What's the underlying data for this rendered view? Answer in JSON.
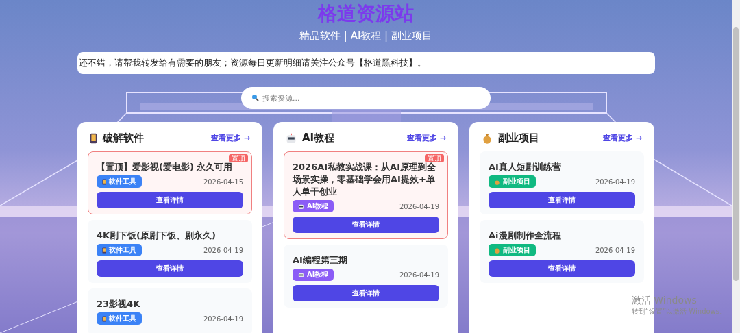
{
  "header": {
    "title": "格道资源站",
    "subtitle": "精品软件 | AI教程 | 副业项目"
  },
  "notice": "还不错，请帮我转发给有需要的朋友；资源每日更新明细请关注公众号【格道黑科技】。",
  "search": {
    "placeholder": "搜索资源..."
  },
  "sections": [
    {
      "kind": "software",
      "title": "破解软件",
      "more": "查看更多 →",
      "items": [
        {
          "title": "【置顶】爱影视(爱电影) 永久可用",
          "tag": "软件工具",
          "date": "2026-04-15",
          "button": "查看详情",
          "pinned": true,
          "badge": "置顶"
        },
        {
          "title": "4K剧下饭(原剧下饭、剧永久)",
          "tag": "软件工具",
          "date": "2026-04-19",
          "button": "查看详情",
          "pinned": false
        },
        {
          "title": "23影视4K",
          "tag": "软件工具",
          "date": "2026-04-19",
          "pinned": false
        }
      ]
    },
    {
      "kind": "ai",
      "title": "AI教程",
      "more": "查看更多 →",
      "items": [
        {
          "title": "2026AI私教实战课：从AI原理到全场景实操，零基础学会用AI提效+单人单干创业",
          "tag": "AI教程",
          "date": "2026-04-19",
          "button": "查看详情",
          "pinned": true,
          "badge": "置顶"
        },
        {
          "title": "AI编程第三期",
          "tag": "AI教程",
          "date": "2026-04-19",
          "button": "查看详情",
          "pinned": false
        }
      ]
    },
    {
      "kind": "side",
      "title": "副业项目",
      "more": "查看更多 →",
      "items": [
        {
          "title": "AI真人短剧训练营",
          "tag": "副业项目",
          "date": "2026-04-19",
          "button": "查看详情",
          "pinned": false
        },
        {
          "title": "Ai漫剧制作全流程",
          "tag": "副业项目",
          "date": "2026-04-19",
          "button": "查看详情",
          "pinned": false
        }
      ]
    }
  ],
  "os_notice": {
    "title": "激活 Windows",
    "text": "转到“设置”以激活 Windows。"
  }
}
